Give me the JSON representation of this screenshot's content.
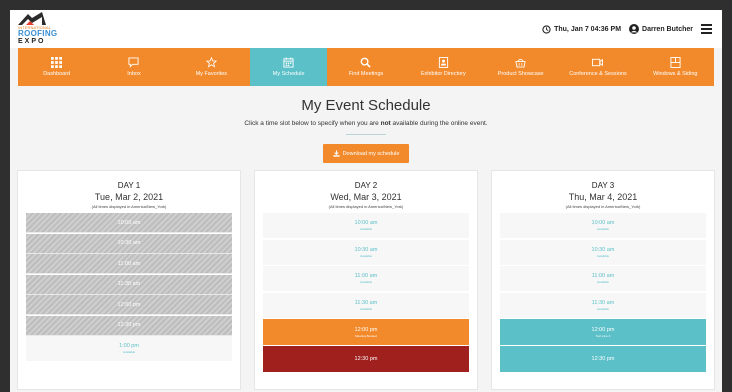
{
  "header": {
    "logo": {
      "line1": "INTERNATIONAL",
      "line2": "ROOFING",
      "line3": "EXPO"
    },
    "datetime": "Thu, Jan 7 04:36 PM",
    "user_name": "Darren Butcher"
  },
  "nav": {
    "items": [
      {
        "label": "Dashboard",
        "icon": "grid-icon"
      },
      {
        "label": "Inbox",
        "icon": "chat-bubble-icon"
      },
      {
        "label": "My Favorites",
        "icon": "star-icon"
      },
      {
        "label": "My Schedule",
        "icon": "calendar-icon",
        "active": true
      },
      {
        "label": "Find Meetings",
        "icon": "search-icon"
      },
      {
        "label": "Exhibitor Directory",
        "icon": "id-card-icon"
      },
      {
        "label": "Product Showcase",
        "icon": "basket-icon"
      },
      {
        "label": "Conference & Sessions",
        "icon": "video-camera-icon"
      },
      {
        "label": "Windows & Siding",
        "icon": "window-icon"
      }
    ]
  },
  "page": {
    "title": "My Event Schedule",
    "subtitle_pre": "Click a time slot below to specify when you are ",
    "subtitle_bold": "not",
    "subtitle_post": " available during the online event.",
    "download_label": "Download my schedule"
  },
  "days": [
    {
      "name": "DAY 1",
      "date": "Tue, Mar 2, 2021",
      "tz": "(All times displayed in America/New_York)",
      "slots": [
        {
          "time": "10:00 am",
          "status": "",
          "state": "blocked"
        },
        {
          "time": "10:30 am",
          "status": "",
          "state": "blocked"
        },
        {
          "time": "11:00 am",
          "status": "",
          "state": "blocked"
        },
        {
          "time": "11:30 am",
          "status": "",
          "state": "blocked"
        },
        {
          "time": "12:00 pm",
          "status": "",
          "state": "blocked"
        },
        {
          "time": "12:30 pm",
          "status": "",
          "state": "blocked"
        },
        {
          "time": "1:00 pm",
          "status": "Available",
          "state": "available"
        }
      ]
    },
    {
      "name": "DAY 2",
      "date": "Wed, Mar 3, 2021",
      "tz": "(All times displayed in America/New_York)",
      "slots": [
        {
          "time": "10:00 am",
          "status": "Available",
          "state": "available"
        },
        {
          "time": "10:30 am",
          "status": "Available",
          "state": "available"
        },
        {
          "time": "11:00 am",
          "status": "Available",
          "state": "available"
        },
        {
          "time": "11:30 am",
          "status": "Available",
          "state": "available"
        },
        {
          "time": "12:00 pm",
          "status": "Meeting Booked",
          "state": "meeting"
        },
        {
          "time": "12:30 pm",
          "status": "",
          "state": "busy"
        }
      ]
    },
    {
      "name": "DAY 3",
      "date": "Thu, Mar 4, 2021",
      "tz": "(All times displayed in America/New_York)",
      "slots": [
        {
          "time": "10:00 am",
          "status": "Available",
          "state": "available"
        },
        {
          "time": "10:30 am",
          "status": "Available",
          "state": "available"
        },
        {
          "time": "11:00 am",
          "status": "Available",
          "state": "available"
        },
        {
          "time": "11:30 am",
          "status": "Available",
          "state": "available"
        },
        {
          "time": "12:00 pm",
          "status": "Text Line 2",
          "state": "teal"
        },
        {
          "time": "12:30 pm",
          "status": "",
          "state": "teal"
        }
      ]
    }
  ],
  "colors": {
    "accent": "#f28a2c",
    "active": "#5bc0c8",
    "busy": "#a0201e",
    "brand_blue": "#3b8fd1"
  }
}
